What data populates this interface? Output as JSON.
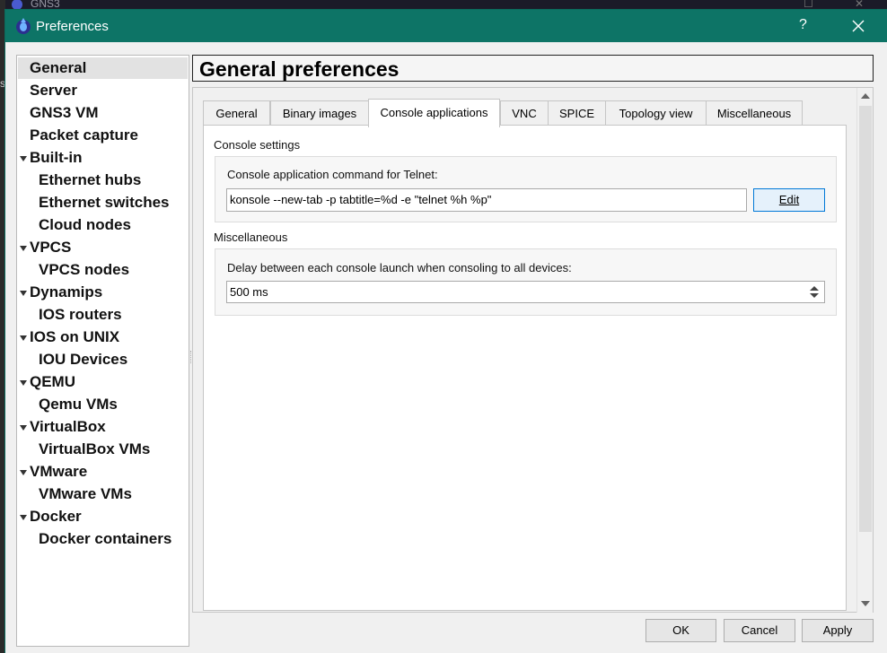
{
  "background_window": {
    "title": "GNS3"
  },
  "left_edge_glyph": "s",
  "dialog": {
    "title": "Preferences",
    "help_label": "?",
    "colors": {
      "titlebar": "#0d7466",
      "selected_item": "#e2e2e2",
      "edit_button_border": "#0078d7"
    }
  },
  "sidebar": {
    "items": [
      {
        "label": "General",
        "level": 0,
        "expandable": false,
        "selected": true
      },
      {
        "label": "Server",
        "level": 0,
        "expandable": false
      },
      {
        "label": "GNS3 VM",
        "level": 0,
        "expandable": false
      },
      {
        "label": "Packet capture",
        "level": 0,
        "expandable": false
      },
      {
        "label": "Built-in",
        "level": 0,
        "expandable": true
      },
      {
        "label": "Ethernet hubs",
        "level": 1
      },
      {
        "label": "Ethernet switches",
        "level": 1
      },
      {
        "label": "Cloud nodes",
        "level": 1
      },
      {
        "label": "VPCS",
        "level": 0,
        "expandable": true
      },
      {
        "label": "VPCS nodes",
        "level": 1
      },
      {
        "label": "Dynamips",
        "level": 0,
        "expandable": true
      },
      {
        "label": "IOS routers",
        "level": 1
      },
      {
        "label": "IOS on UNIX",
        "level": 0,
        "expandable": true
      },
      {
        "label": "IOU Devices",
        "level": 1
      },
      {
        "label": "QEMU",
        "level": 0,
        "expandable": true
      },
      {
        "label": "Qemu VMs",
        "level": 1
      },
      {
        "label": "VirtualBox",
        "level": 0,
        "expandable": true
      },
      {
        "label": "VirtualBox VMs",
        "level": 1
      },
      {
        "label": "VMware",
        "level": 0,
        "expandable": true
      },
      {
        "label": "VMware VMs",
        "level": 1
      },
      {
        "label": "Docker",
        "level": 0,
        "expandable": true
      },
      {
        "label": "Docker containers",
        "level": 1
      }
    ]
  },
  "main": {
    "header": "General preferences",
    "tabs": [
      {
        "label": "General"
      },
      {
        "label": "Binary images"
      },
      {
        "label": "Console applications",
        "active": true
      },
      {
        "label": "VNC"
      },
      {
        "label": "SPICE"
      },
      {
        "label": "Topology view"
      },
      {
        "label": "Miscellaneous"
      }
    ],
    "console_settings": {
      "section_label": "Console settings",
      "telnet_label": "Console application command for Telnet:",
      "telnet_value": "konsole --new-tab -p tabtitle=%d -e \"telnet %h %p\"",
      "edit_label": "Edit"
    },
    "miscellaneous": {
      "section_label": "Miscellaneous",
      "delay_label": "Delay between each console launch when consoling to all devices:",
      "delay_value": "500 ms"
    }
  },
  "footer": {
    "ok_label": "OK",
    "cancel_label": "Cancel",
    "apply_label": "Apply"
  }
}
